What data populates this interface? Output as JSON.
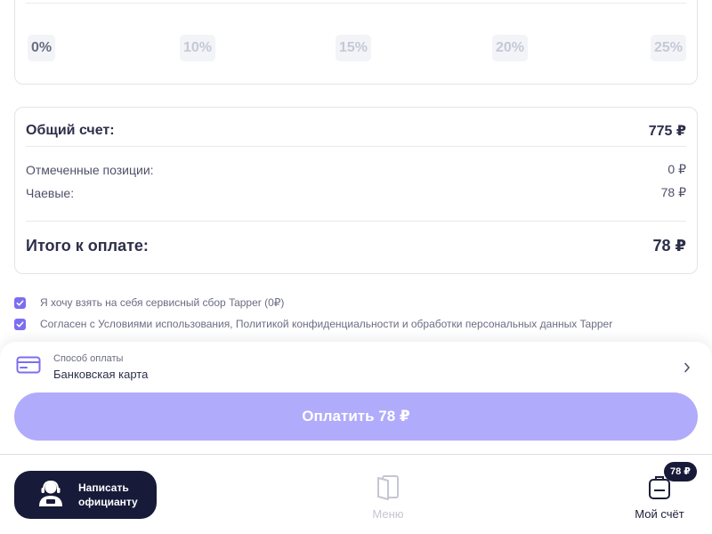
{
  "tips": {
    "options": [
      "0%",
      "10%",
      "15%",
      "20%",
      "25%"
    ],
    "selected": "0%"
  },
  "bill": {
    "total_label": "Общий счет:",
    "total_value": "775 ₽",
    "marked_label": "Отмеченные позиции:",
    "marked_value": "0 ₽",
    "tips_label": "Чаевые:",
    "tips_value": "78 ₽",
    "grand_label": "Итого к оплате:",
    "grand_value": "78 ₽"
  },
  "consents": {
    "service_fee": "Я хочу взять на себя сервисный сбор Tapper (0₽)",
    "terms": "Согласен с Условиями использования, Политикой конфиденциальности и обработки персональных данных Tapper"
  },
  "payment": {
    "method_label": "Способ оплаты",
    "method_value": "Банковская карта",
    "pay_button": "Оплатить 78 ₽"
  },
  "bottom_nav": {
    "waiter_button": "Написать официанту",
    "menu_label": "Меню",
    "my_check_label": "Мой счёт",
    "my_check_badge": "78 ₽"
  },
  "colors": {
    "accent": "#7c6ef0",
    "pay_button": "#b1abfb",
    "dark": "#171a38"
  },
  "icons": {
    "card": "credit-card-icon",
    "chevron": "chevron-right-icon",
    "waiter": "waiter-icon",
    "menu": "menu-book-icon",
    "check": "bag-icon"
  }
}
